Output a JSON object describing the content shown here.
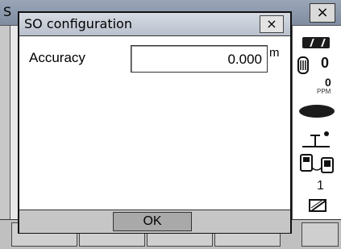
{
  "background_window": {
    "title_fragment": "S",
    "close_label": "×"
  },
  "dialog": {
    "title": "SO configuration",
    "close_label": "×",
    "accuracy": {
      "label": "Accuracy",
      "value": "0.000",
      "unit": "m"
    },
    "ok_label": "OK"
  },
  "status_bar": {
    "battery_icon": "battery-icon",
    "prism_constant": "0",
    "ppm_value": "0",
    "ppm_label": "PPM",
    "laser_icon": "laser-icon",
    "level_icon": "level-icon",
    "bluetooth_icon": "bluetooth-icon",
    "channel": "1",
    "input_mode_icon": "input-mode-icon"
  }
}
